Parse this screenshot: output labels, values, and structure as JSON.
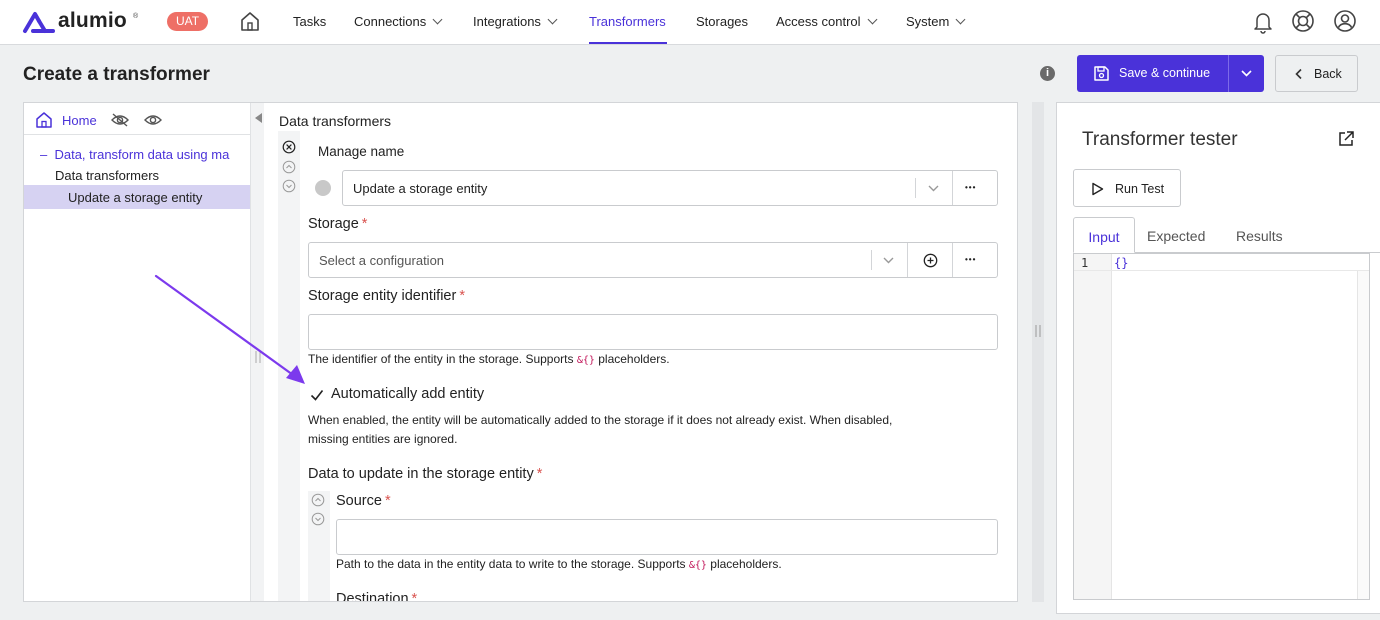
{
  "app": {
    "logo_text": "alumio",
    "logo_mark": "®",
    "env_badge": "UAT"
  },
  "nav": {
    "items": [
      {
        "label": "Tasks"
      },
      {
        "label": "Connections"
      },
      {
        "label": "Integrations"
      },
      {
        "label": "Transformers",
        "active": true
      },
      {
        "label": "Storages"
      },
      {
        "label": "Access control"
      },
      {
        "label": "System"
      }
    ]
  },
  "header": {
    "title": "Create a transformer",
    "info_glyph": "i",
    "save_label": "Save & continue",
    "back_label": "Back"
  },
  "tree": {
    "home_label": "Home",
    "items": [
      {
        "label": "Data, transform data using ma",
        "prefix": "–"
      },
      {
        "label": "Data transformers"
      },
      {
        "label": "Update a storage entity",
        "selected": true
      }
    ]
  },
  "form": {
    "section_title": "Data transformers",
    "manage_name_label": "Manage name",
    "transformer_value": "Update a storage entity",
    "storage_label": "Storage",
    "storage_placeholder": "Select a configuration",
    "required_mark": "*",
    "entity_id_label": "Storage entity identifier",
    "entity_id_value": "",
    "entity_id_help_pre": "The identifier of the entity in the storage. Supports ",
    "placeholder_token": "&{}",
    "entity_id_help_post": " placeholders.",
    "auto_add_label": "Automatically add entity",
    "auto_add_checked": true,
    "auto_add_help_1": "When enabled, the entity will be automatically added to the storage if it does not already exist. When disabled,",
    "auto_add_help_2": "missing entities are ignored.",
    "data_update_label": "Data to update in the storage entity",
    "source_label": "Source",
    "source_value": "",
    "source_help_pre": "Path to the data in the entity data to write to the storage. Supports ",
    "source_help_post": " placeholders.",
    "destination_label": "Destination",
    "more_glyph": "•••",
    "close_glyph": "×"
  },
  "tester": {
    "title": "Transformer tester",
    "run_label": "Run Test",
    "tabs": [
      {
        "label": "Input",
        "active": true
      },
      {
        "label": "Expected"
      },
      {
        "label": "Results"
      }
    ],
    "editor": {
      "line_number": "1",
      "code": "{}"
    }
  },
  "colors": {
    "accent": "#4a32d9",
    "badge": "#ee6f66",
    "required": "#d9534f",
    "arrow": "#7c3aed"
  }
}
